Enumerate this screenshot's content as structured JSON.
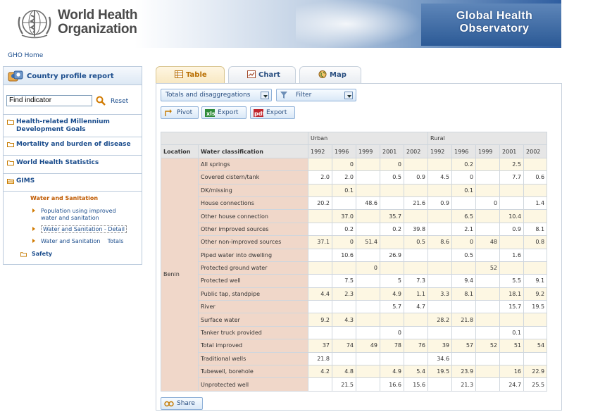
{
  "header": {
    "org_line1": "World Health",
    "org_line2": "Organization",
    "gho_line1": "Global Health",
    "gho_line2": "Observatory",
    "home_link": "GHO Home"
  },
  "sidebar": {
    "title": "Country profile report",
    "find_value": "Find indicator",
    "reset": "Reset",
    "sections": [
      {
        "label_line1": "Health-related Millennium",
        "label_line2": "Development Goals"
      },
      {
        "label_line1": "Mortality and burden of disease"
      },
      {
        "label_line1": "World Health Statistics"
      },
      {
        "label_line1": "GIMS"
      }
    ],
    "gims_sub": "Water and Sanitation",
    "gims_items": [
      {
        "line1": "Population using improved",
        "line2": "water and sanitation"
      },
      {
        "line1": "Water and Sanitation - Detail"
      },
      {
        "line1": "Water and Sanitation    Totals"
      }
    ],
    "safety": "Safety"
  },
  "tabs": [
    {
      "label": "Table",
      "icon": "table-icon",
      "active": true
    },
    {
      "label": "Chart",
      "icon": "chart-icon",
      "active": false
    },
    {
      "label": "Map",
      "icon": "map-icon",
      "active": false
    }
  ],
  "toolbar": {
    "disagg_label": "Totals and disaggregations",
    "filter_label": "Filter",
    "pivot_label": "Pivot",
    "export_xls_label": "Export",
    "export_pdf_label": "Export",
    "share_label": "Share"
  },
  "table": {
    "group_headers": [
      "Urban",
      "Rural"
    ],
    "col_location": "Location",
    "col_class": "Water classification",
    "years": [
      "1992",
      "1996",
      "1999",
      "2001",
      "2002"
    ],
    "location": "Benin",
    "rows": [
      {
        "name": "All springs",
        "urban": [
          "",
          "0",
          "",
          "0",
          ""
        ],
        "rural": [
          "",
          "0.2",
          "",
          "2.5",
          ""
        ]
      },
      {
        "name": "Covered cistern/tank",
        "urban": [
          "2.0",
          "2.0",
          "",
          "0.5",
          "0.9"
        ],
        "rural": [
          "4.5",
          "0",
          "",
          "7.7",
          "0.6"
        ]
      },
      {
        "name": "DK/missing",
        "urban": [
          "",
          "0.1",
          "",
          "",
          ""
        ],
        "rural": [
          "",
          "0.1",
          "",
          "",
          ""
        ]
      },
      {
        "name": "House connections",
        "urban": [
          "20.2",
          "",
          "48.6",
          "",
          "21.6"
        ],
        "rural": [
          "0.9",
          "",
          "0",
          "",
          "1.4"
        ]
      },
      {
        "name": "Other house connection",
        "urban": [
          "",
          "37.0",
          "",
          "35.7",
          ""
        ],
        "rural": [
          "",
          "6.5",
          "",
          "10.4",
          ""
        ]
      },
      {
        "name": "Other improved sources",
        "urban": [
          "",
          "0.2",
          "",
          "0.2",
          "39.8"
        ],
        "rural": [
          "",
          "2.1",
          "",
          "0.9",
          "8.1"
        ]
      },
      {
        "name": "Other non-improved sources",
        "urban": [
          "37.1",
          "0",
          "51.4",
          "",
          "0.5"
        ],
        "rural": [
          "8.6",
          "0",
          "48",
          "",
          "0.8"
        ]
      },
      {
        "name": "Piped water into dwelling",
        "urban": [
          "",
          "10.6",
          "",
          "26.9",
          ""
        ],
        "rural": [
          "",
          "0.5",
          "",
          "1.6",
          ""
        ]
      },
      {
        "name": "Protected ground water",
        "urban": [
          "",
          "",
          "0",
          "",
          ""
        ],
        "rural": [
          "",
          "",
          "52",
          "",
          ""
        ]
      },
      {
        "name": "Protected well",
        "urban": [
          "",
          "7.5",
          "",
          "5",
          "7.3"
        ],
        "rural": [
          "",
          "9.4",
          "",
          "5.5",
          "9.1"
        ]
      },
      {
        "name": "Public tap, standpipe",
        "urban": [
          "4.4",
          "2.3",
          "",
          "4.9",
          "1.1"
        ],
        "rural": [
          "3.3",
          "8.1",
          "",
          "18.1",
          "9.2"
        ]
      },
      {
        "name": "River",
        "urban": [
          "",
          "",
          "",
          "5.7",
          "4.7"
        ],
        "rural": [
          "",
          "",
          "",
          "15.7",
          "19.5"
        ]
      },
      {
        "name": "Surface water",
        "urban": [
          "9.2",
          "4.3",
          "",
          "",
          ""
        ],
        "rural": [
          "28.2",
          "21.8",
          "",
          "",
          ""
        ]
      },
      {
        "name": "Tanker truck provided",
        "urban": [
          "",
          "",
          "",
          "0",
          ""
        ],
        "rural": [
          "",
          "",
          "",
          "0.1",
          ""
        ]
      },
      {
        "name": "Total improved",
        "urban": [
          "37",
          "74",
          "49",
          "78",
          "76"
        ],
        "rural": [
          "39",
          "57",
          "52",
          "51",
          "54"
        ]
      },
      {
        "name": "Traditional wells",
        "urban": [
          "21.8",
          "",
          "",
          "",
          ""
        ],
        "rural": [
          "34.6",
          "",
          "",
          "",
          ""
        ]
      },
      {
        "name": "Tubewell, borehole",
        "urban": [
          "4.2",
          "4.8",
          "",
          "4.9",
          "5.4"
        ],
        "rural": [
          "19.5",
          "23.9",
          "",
          "16",
          "22.9"
        ]
      },
      {
        "name": "Unprotected well",
        "urban": [
          "",
          "21.5",
          "",
          "16.6",
          "15.6"
        ],
        "rural": [
          "",
          "21.3",
          "",
          "24.7",
          "25.5"
        ]
      }
    ]
  }
}
